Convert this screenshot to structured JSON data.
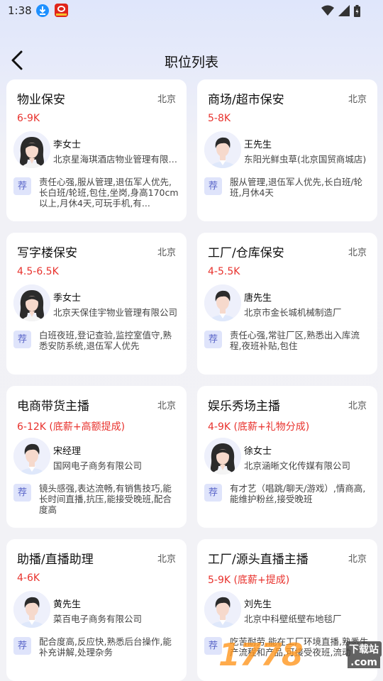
{
  "status_bar": {
    "time": "1:38"
  },
  "header": {
    "title": "职位列表"
  },
  "cards": [
    {
      "title": "物业保安",
      "city": "北京",
      "salary": "6-9K",
      "person": "李女士",
      "gender": "female",
      "company": "北京星海琪酒店物业管理有限公司",
      "tag": "荐",
      "desc": "责任心强,服从管理,退伍军人优先,长白班/轮班,包住,坐岗,身高170cm以上,月休4天,可玩手机,有..."
    },
    {
      "title": "商场/超市保安",
      "city": "北京",
      "salary": "5-8K",
      "person": "王先生",
      "gender": "male",
      "company": "东阳光鲜虫草(北京国贸商城店)",
      "tag": "荐",
      "desc": "服从管理,退伍军人优先,长白班/轮班,月休4天"
    },
    {
      "title": "写字楼保安",
      "city": "北京",
      "salary": "4.5-6.5K",
      "person": "季女士",
      "gender": "female",
      "company": "北京天保佳宇物业管理有限公司",
      "tag": "荐",
      "desc": "白班夜班,登记查验,监控室值守,熟悉安防系统,退伍军人优先"
    },
    {
      "title": "工厂/仓库保安",
      "city": "北京",
      "salary": "4-5.5K",
      "person": "唐先生",
      "gender": "male",
      "company": "北京市金长城机械制造厂",
      "tag": "荐",
      "desc": "责任心强,常驻厂区,熟悉出入库流程,夜班补贴,包住"
    },
    {
      "title": "电商带货主播",
      "city": "北京",
      "salary": "6-12K (底薪+高额提成)",
      "person": "宋经理",
      "gender": "male",
      "company": "国网电子商务有限公司",
      "tag": "荐",
      "desc": "镜头感强,表达流畅,有销售技巧,能长时间直播,抗压,能接受晚班,配合度高"
    },
    {
      "title": "娱乐秀场主播",
      "city": "北京",
      "salary": "4-9K (底薪+礼物分成)",
      "person": "徐女士",
      "gender": "female",
      "company": "北京涵晰文化传媒有限公司",
      "tag": "荐",
      "desc": "有才艺（唱跳/聊天/游戏）,情商高,能维护粉丝,接受晚班"
    },
    {
      "title": "助播/直播助理",
      "city": "北京",
      "salary": "4-6K",
      "person": "黄先生",
      "gender": "male",
      "company": "菜百电子商务有限公司",
      "tag": "荐",
      "desc": "配合度高,反应快,熟悉后台操作,能补充讲解,处理杂务"
    },
    {
      "title": "工厂/源头直播主播",
      "city": "北京",
      "salary": "5-9K (底薪+提成)",
      "person": "刘先生",
      "gender": "male",
      "company": "北京中科壁纸壁布地毯厂",
      "tag": "荐",
      "desc": "吃苦耐劳,能在工厂环境直播,熟悉生产流程和产品,可接受夜班,流动"
    }
  ],
  "watermark": {
    "main": "1778",
    "sub": "下载站",
    "domain": ".com"
  }
}
